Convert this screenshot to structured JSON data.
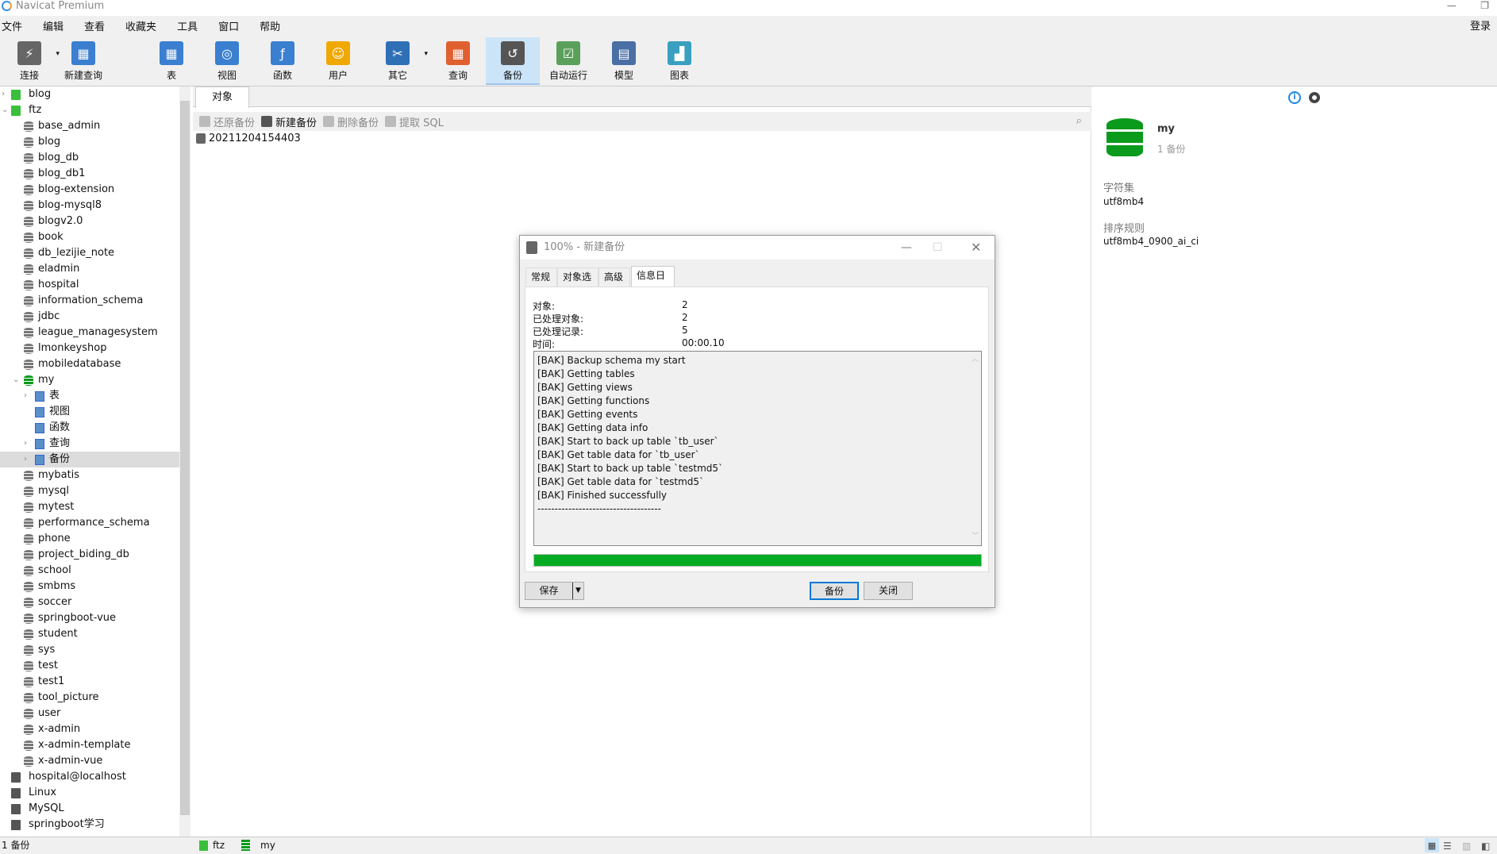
{
  "app": {
    "title": "Navicat Premium",
    "login": "登录"
  },
  "menu": [
    "文件",
    "编辑",
    "查看",
    "收藏夹",
    "工具",
    "窗口",
    "帮助"
  ],
  "toolbar": [
    {
      "label": "连接",
      "icon": "plug-icon",
      "color": "#666",
      "dropdown": true
    },
    {
      "label": "新建查询",
      "icon": "new-query-icon",
      "color": "#3a7fd0"
    },
    {
      "label": "表",
      "icon": "table-icon",
      "color": "#3a7fd0"
    },
    {
      "label": "视图",
      "icon": "view-icon",
      "color": "#3a7fd0"
    },
    {
      "label": "函数",
      "icon": "function-icon",
      "color": "#3a7fd0"
    },
    {
      "label": "用户",
      "icon": "user-icon",
      "color": "#f0a800"
    },
    {
      "label": "其它",
      "icon": "tools-icon",
      "color": "#2f6fb5",
      "dropdown": true
    },
    {
      "label": "查询",
      "icon": "query-icon",
      "color": "#e06030"
    },
    {
      "label": "备份",
      "icon": "backup-icon",
      "color": "#555",
      "active": true
    },
    {
      "label": "自动运行",
      "icon": "schedule-icon",
      "color": "#5aa05a"
    },
    {
      "label": "模型",
      "icon": "model-icon",
      "color": "#4a6fa5"
    },
    {
      "label": "图表",
      "icon": "chart-icon",
      "color": "#3aa0c0"
    }
  ],
  "tree": [
    {
      "label": "blog",
      "level": 0,
      "type": "conn",
      "arrow": "›"
    },
    {
      "label": "ftz",
      "level": 0,
      "type": "conn",
      "arrow": "⌄"
    },
    {
      "label": "base_admin",
      "level": 1,
      "type": "db"
    },
    {
      "label": "blog",
      "level": 1,
      "type": "db"
    },
    {
      "label": "blog_db",
      "level": 1,
      "type": "db"
    },
    {
      "label": "blog_db1",
      "level": 1,
      "type": "db"
    },
    {
      "label": "blog-extension",
      "level": 1,
      "type": "db"
    },
    {
      "label": "blog-mysql8",
      "level": 1,
      "type": "db"
    },
    {
      "label": "blogv2.0",
      "level": 1,
      "type": "db"
    },
    {
      "label": "book",
      "level": 1,
      "type": "db"
    },
    {
      "label": "db_lezijie_note",
      "level": 1,
      "type": "db"
    },
    {
      "label": "eladmin",
      "level": 1,
      "type": "db"
    },
    {
      "label": "hospital",
      "level": 1,
      "type": "db"
    },
    {
      "label": "information_schema",
      "level": 1,
      "type": "db"
    },
    {
      "label": "jdbc",
      "level": 1,
      "type": "db"
    },
    {
      "label": "league_managesystem",
      "level": 1,
      "type": "db"
    },
    {
      "label": "lmonkeyshop",
      "level": 1,
      "type": "db"
    },
    {
      "label": "mobiledatabase",
      "level": 1,
      "type": "db"
    },
    {
      "label": "my",
      "level": 1,
      "type": "dbopen",
      "arrow": "⌄"
    },
    {
      "label": "表",
      "level": 2,
      "type": "sub",
      "arrow": "›"
    },
    {
      "label": "视图",
      "level": 2,
      "type": "sub"
    },
    {
      "label": "函数",
      "level": 2,
      "type": "sub"
    },
    {
      "label": "查询",
      "level": 2,
      "type": "sub",
      "arrow": "›"
    },
    {
      "label": "备份",
      "level": 2,
      "type": "sub",
      "arrow": "›",
      "selected": true
    },
    {
      "label": "mybatis",
      "level": 1,
      "type": "db"
    },
    {
      "label": "mysql",
      "level": 1,
      "type": "db"
    },
    {
      "label": "mytest",
      "level": 1,
      "type": "db"
    },
    {
      "label": "performance_schema",
      "level": 1,
      "type": "db"
    },
    {
      "label": "phone",
      "level": 1,
      "type": "db"
    },
    {
      "label": "project_biding_db",
      "level": 1,
      "type": "db"
    },
    {
      "label": "school",
      "level": 1,
      "type": "db"
    },
    {
      "label": "smbms",
      "level": 1,
      "type": "db"
    },
    {
      "label": "soccer",
      "level": 1,
      "type": "db"
    },
    {
      "label": "springboot-vue",
      "level": 1,
      "type": "db"
    },
    {
      "label": "student",
      "level": 1,
      "type": "db"
    },
    {
      "label": "sys",
      "level": 1,
      "type": "db"
    },
    {
      "label": "test",
      "level": 1,
      "type": "db"
    },
    {
      "label": "test1",
      "level": 1,
      "type": "db"
    },
    {
      "label": "tool_picture",
      "level": 1,
      "type": "db"
    },
    {
      "label": "user",
      "level": 1,
      "type": "db"
    },
    {
      "label": "x-admin",
      "level": 1,
      "type": "db"
    },
    {
      "label": "x-admin-template",
      "level": 1,
      "type": "db"
    },
    {
      "label": "x-admin-vue",
      "level": 1,
      "type": "db"
    },
    {
      "label": "hospital@localhost",
      "level": 0,
      "type": "connoff"
    },
    {
      "label": "Linux",
      "level": 0,
      "type": "connoff"
    },
    {
      "label": "MySQL",
      "level": 0,
      "type": "connoff"
    },
    {
      "label": "springboot学习",
      "level": 0,
      "type": "connoff"
    }
  ],
  "main": {
    "tab": "对象",
    "actions": [
      {
        "label": "还原备份",
        "enabled": false
      },
      {
        "label": "新建备份",
        "enabled": true
      },
      {
        "label": "删除备份",
        "enabled": false
      },
      {
        "label": "提取 SQL",
        "enabled": false
      }
    ],
    "file": "20211204154403"
  },
  "info": {
    "name": "my",
    "sub": "1 备份",
    "charset_label": "字符集",
    "charset": "utf8mb4",
    "collation_label": "排序规则",
    "collation": "utf8mb4_0900_ai_ci"
  },
  "status": {
    "left": "1 备份",
    "conn": "ftz",
    "db": "my"
  },
  "dialog": {
    "title": "100% - 新建备份",
    "tabs": [
      "常规",
      "对象选择",
      "高级",
      "信息日志"
    ],
    "active_tab": 3,
    "stats": [
      {
        "label": "对象:",
        "value": "2"
      },
      {
        "label": "已处理对象:",
        "value": "2"
      },
      {
        "label": "已处理记录:",
        "value": "5"
      },
      {
        "label": "时间:",
        "value": "00:00.10"
      }
    ],
    "log": [
      "[BAK] Backup schema my start",
      "[BAK] Getting tables",
      "[BAK] Getting views",
      "[BAK] Getting functions",
      "[BAK] Getting events",
      "[BAK] Getting data info",
      "[BAK] Start to back up table `tb_user`",
      "[BAK] Get table data for `tb_user`",
      "[BAK] Start to back up table `testmd5`",
      "[BAK] Get table data for `testmd5`",
      "[BAK] Finished successfully",
      "------------------------------------"
    ],
    "progress": 100,
    "progress_color": "#06ad24",
    "save": "保存",
    "backup": "备份",
    "close": "关闭"
  }
}
